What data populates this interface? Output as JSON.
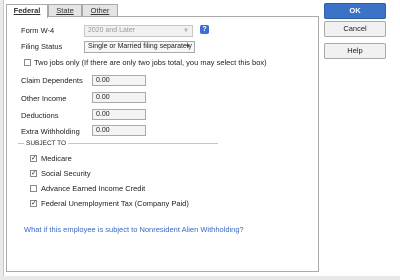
{
  "tabs": [
    {
      "label": "Federal",
      "active": true
    },
    {
      "label": "State",
      "active": false
    },
    {
      "label": "Other",
      "active": false
    }
  ],
  "form_w4": {
    "label": "Form W-4",
    "value": "2020 and Later"
  },
  "filing_status": {
    "label": "Filing Status",
    "value": "Single or Married filing separately"
  },
  "two_jobs": {
    "label": "Two jobs only (If there are only two jobs total, you may select this box)",
    "checked": false
  },
  "fields": {
    "claim_dependents": {
      "label": "Claim Dependents",
      "value": "0.00"
    },
    "other_income": {
      "label": "Other Income",
      "value": "0.00"
    },
    "deductions": {
      "label": "Deductions",
      "value": "0.00"
    },
    "extra_withholding": {
      "label": "Extra Withholding",
      "value": "0.00"
    }
  },
  "subject_to": {
    "title": "SUBJECT TO",
    "items": [
      {
        "label": "Medicare",
        "checked": true
      },
      {
        "label": "Social Security",
        "checked": true
      },
      {
        "label": "Advance Earned Income Credit",
        "checked": false
      },
      {
        "label": "Federal Unemployment Tax (Company Paid)",
        "checked": true
      }
    ]
  },
  "nonresident_link": "What if this employee is subject to Nonresident Alien Withholding?",
  "buttons": {
    "ok": "OK",
    "cancel": "Cancel",
    "help": "Help"
  },
  "icons": {
    "help": "question-mark-icon",
    "dropdown": "chevron-down-icon",
    "check": "checkmark-icon"
  },
  "colors": {
    "accent": "#3b73c8",
    "link": "#3a68c4"
  }
}
